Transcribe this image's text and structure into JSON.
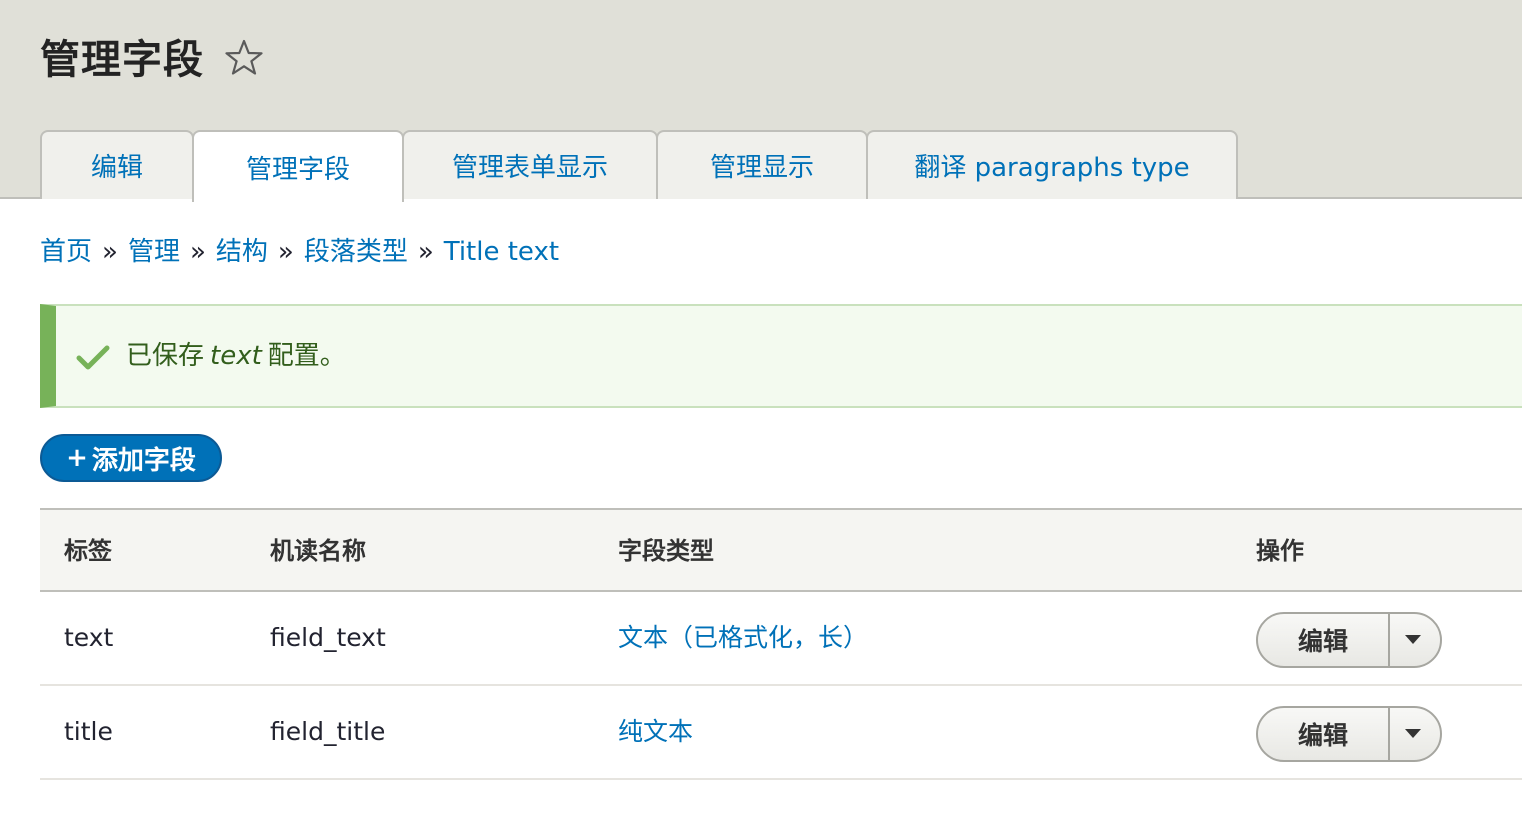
{
  "header": {
    "title": "管理字段",
    "tabs": [
      {
        "label": "编辑"
      },
      {
        "label": "管理字段"
      },
      {
        "label": "管理表单显示"
      },
      {
        "label": "管理显示"
      },
      {
        "label": "翻译 paragraphs type"
      }
    ],
    "active_tab": 1
  },
  "breadcrumb": {
    "items": [
      {
        "label": "首页"
      },
      {
        "label": "管理"
      },
      {
        "label": "结构"
      },
      {
        "label": "段落类型"
      },
      {
        "label": "Title text"
      }
    ],
    "separator": "»"
  },
  "message": {
    "prefix": "已保存",
    "name": "text",
    "suffix": "配置。"
  },
  "add_field": {
    "plus": "+",
    "label": "添加字段"
  },
  "table": {
    "columns": [
      "标签",
      "机读名称",
      "字段类型",
      "操作"
    ],
    "rows": [
      {
        "label": "text",
        "machine_name": "field_text",
        "field_type": "文本（已格式化，长）",
        "operation": "编辑"
      },
      {
        "label": "title",
        "machine_name": "field_title",
        "field_type": "纯文本",
        "operation": "编辑"
      }
    ]
  },
  "colors": {
    "link": "#0071b8",
    "header_bg": "#e0e0d8",
    "status_border": "#77b259",
    "status_bg": "#f3faef",
    "button_primary": "#0071b8"
  },
  "icons": {
    "favorite": "star-outline-icon",
    "status": "check-icon",
    "dropbutton_toggle": "chevron-down-icon"
  }
}
